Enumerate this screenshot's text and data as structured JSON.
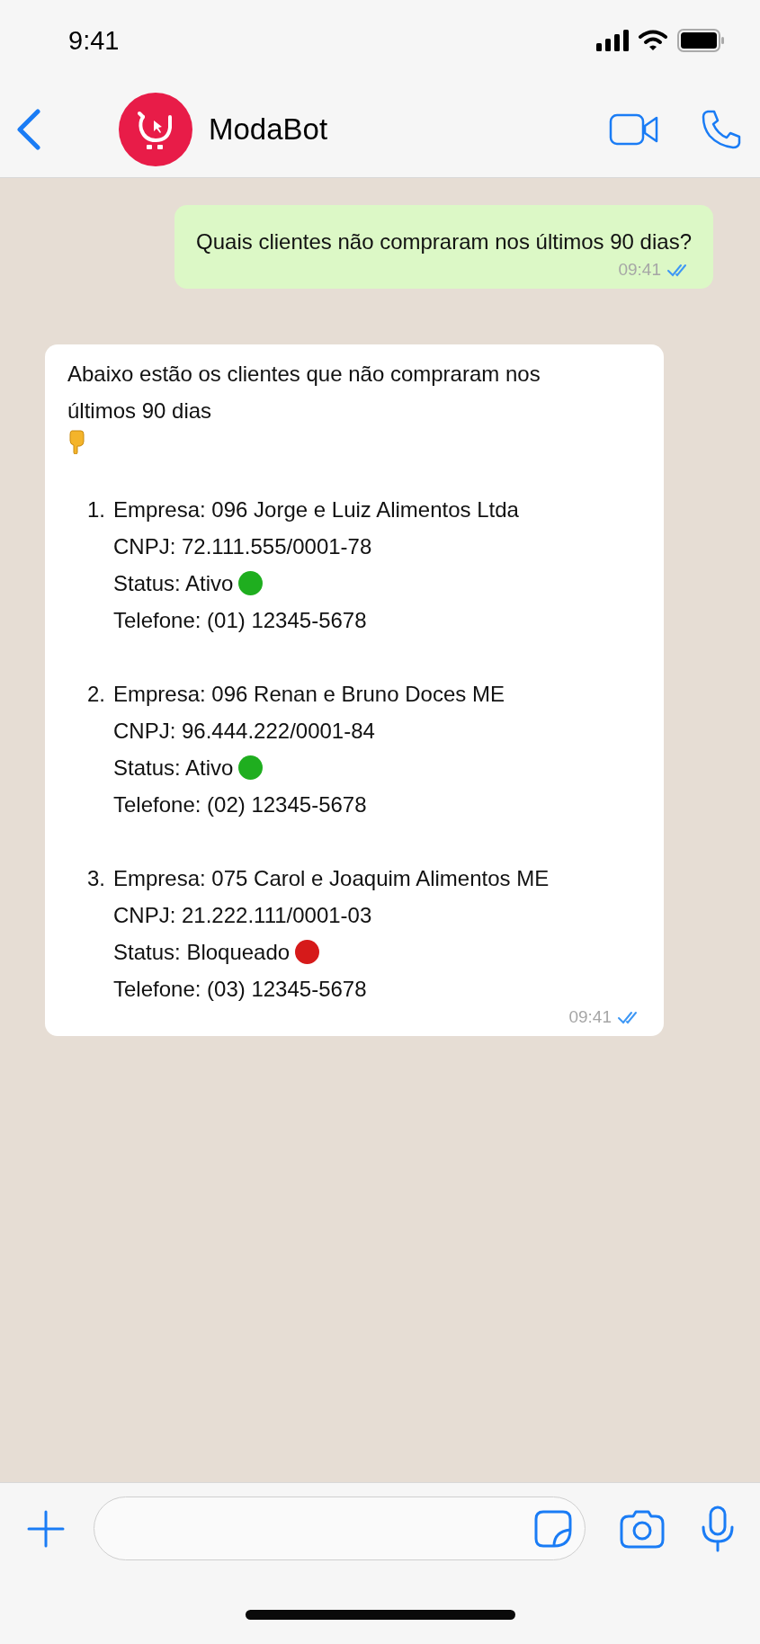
{
  "status_bar": {
    "time": "9:41"
  },
  "header": {
    "contact_name": "ModaBot"
  },
  "messages": [
    {
      "kind": "outgoing",
      "text": "Quais clientes não compraram nos últimos 90 dias?",
      "time": "09:41",
      "read": true
    },
    {
      "kind": "incoming",
      "intro": "Abaixo estão os clientes que não compraram nos últimos 90 dias",
      "time": "09:41",
      "read": true,
      "clients": [
        {
          "number": "1.",
          "company": "Empresa: 096 Jorge e Luiz Alimentos Ltda",
          "cnpj": "CNPJ: 72.111.555/0001-78",
          "status": "Status: Ativo",
          "color": "#1fae1f",
          "phone": "Telefone: (01) 12345-5678"
        },
        {
          "number": "2.",
          "company": "Empresa: 096 Renan e Bruno Doces ME",
          "cnpj": "CNPJ: 96.444.222/0001-84",
          "status": "Status: Ativo",
          "color": "#1fae1f",
          "phone": "Telefone: (02) 12345-5678"
        },
        {
          "number": "3.",
          "company": "Empresa: 075 Carol e Joaquim Alimentos ME",
          "cnpj": "CNPJ: 21.222.111/0001-03",
          "status": "Status: Bloqueado",
          "color": "#d61a1a",
          "phone": "Telefone: (03) 12345-5678"
        }
      ]
    }
  ]
}
